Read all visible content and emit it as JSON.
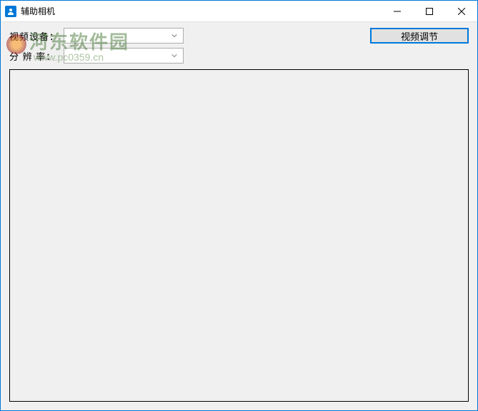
{
  "window": {
    "title": "辅助相机"
  },
  "form": {
    "video_device_label": "视频设备：",
    "video_device_value": "",
    "resolution_label": "分 辨 率：",
    "resolution_value": ""
  },
  "buttons": {
    "video_adjust": "视频调节"
  },
  "watermark": {
    "text": "河东软件园",
    "url": "www.pc0359.cn"
  }
}
